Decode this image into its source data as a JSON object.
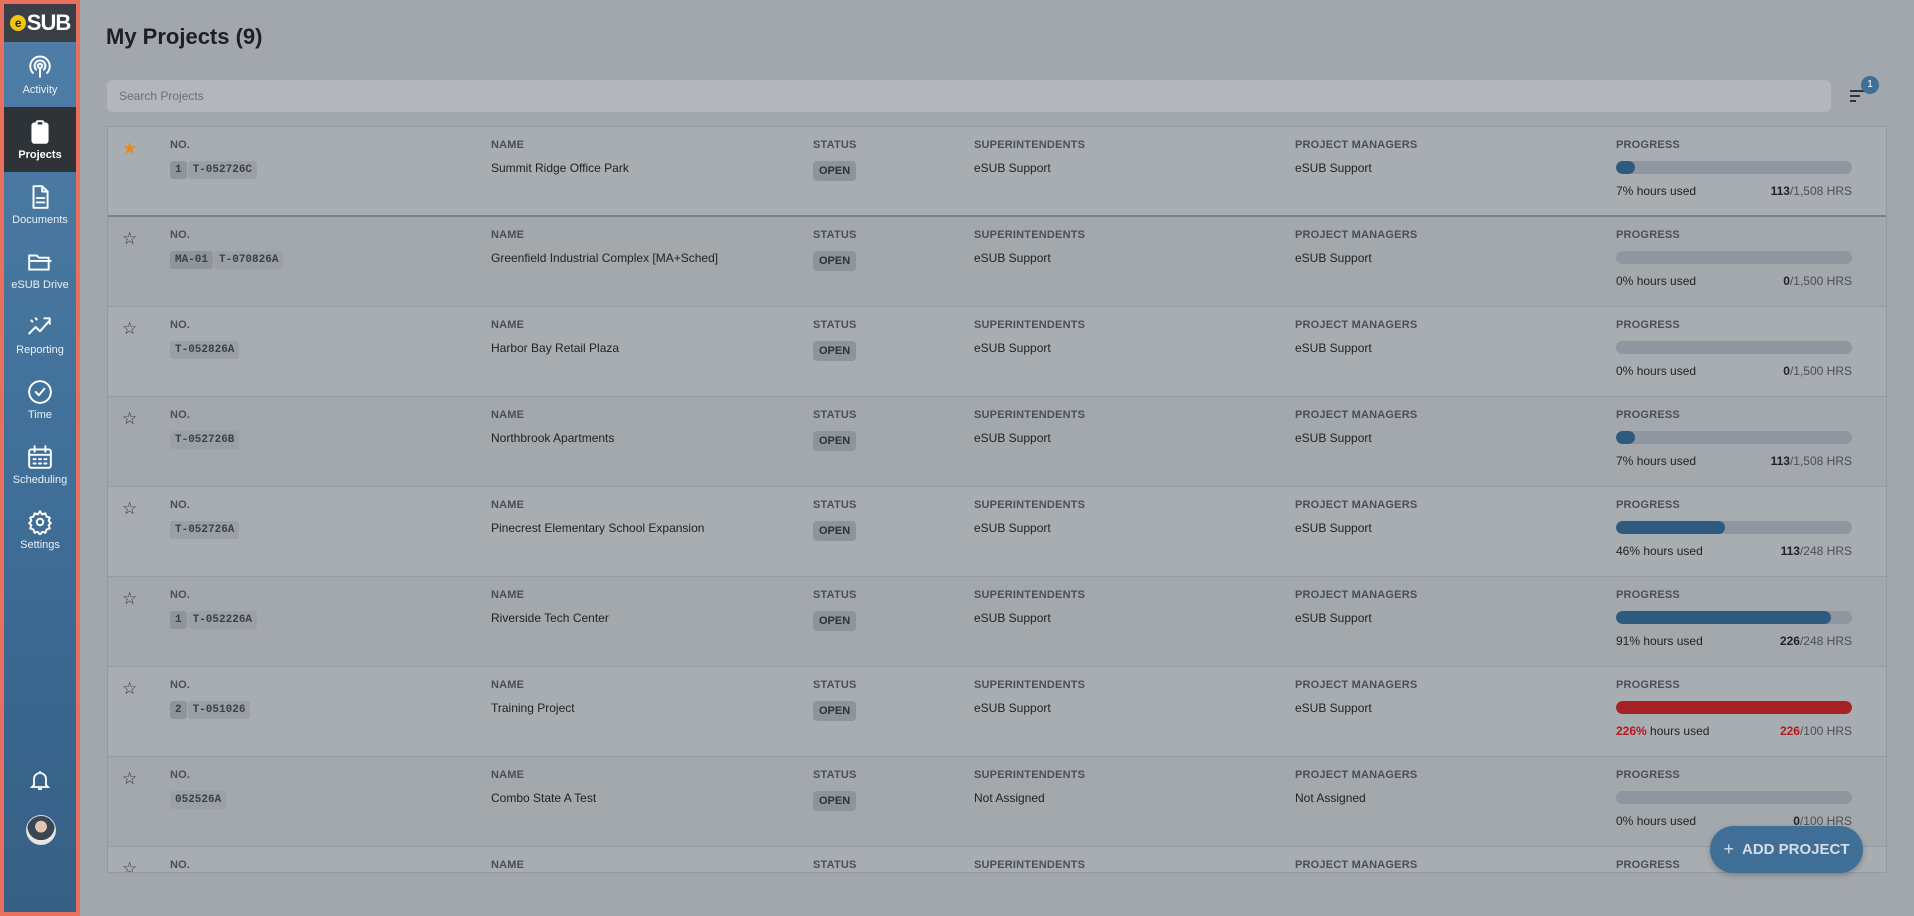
{
  "app": {
    "logo_text": "SUB",
    "logo_e": "e"
  },
  "sidebar": {
    "items": [
      {
        "label": "Activity",
        "icon": "activity-icon"
      },
      {
        "label": "Projects",
        "icon": "clipboard-icon",
        "active": true
      },
      {
        "label": "Documents",
        "icon": "document-icon"
      },
      {
        "label": "eSUB Drive",
        "icon": "folder-icon"
      },
      {
        "label": "Reporting",
        "icon": "reporting-icon"
      },
      {
        "label": "Time",
        "icon": "clock-icon"
      },
      {
        "label": "Scheduling",
        "icon": "calendar-icon"
      },
      {
        "label": "Settings",
        "icon": "gear-icon"
      }
    ]
  },
  "header": {
    "title": "My Projects (9)"
  },
  "search": {
    "placeholder": "Search Projects"
  },
  "filter": {
    "badge": "1"
  },
  "columns": {
    "no": "NO.",
    "name": "NAME",
    "status": "STATUS",
    "superintendents": "SUPERINTENDENTS",
    "project_managers": "PROJECT MANAGERS",
    "progress": "PROGRESS"
  },
  "projects": [
    {
      "starred": true,
      "prefix": "1",
      "number": "T-052726C",
      "name": "Summit Ridge Office Park",
      "status": "OPEN",
      "superintendents": "eSUB Support",
      "project_managers": "eSUB Support",
      "progress_pct": 7,
      "pct_label": "7%",
      "hours_label": "hours used",
      "used": "113",
      "total": "/1,508 HRS",
      "over": false
    },
    {
      "starred": false,
      "prefix": "MA-01",
      "number": "T-070826A",
      "name": "Greenfield Industrial Complex [MA+Sched]",
      "status": "OPEN",
      "superintendents": "eSUB Support",
      "project_managers": "eSUB Support",
      "progress_pct": 0,
      "pct_label": "0%",
      "hours_label": "hours used",
      "used": "0",
      "total": "/1,500 HRS",
      "over": false
    },
    {
      "starred": false,
      "prefix": "",
      "number": "T-052826A",
      "name": "Harbor Bay Retail Plaza",
      "status": "OPEN",
      "superintendents": "eSUB Support",
      "project_managers": "eSUB Support",
      "progress_pct": 0,
      "pct_label": "0%",
      "hours_label": "hours used",
      "used": "0",
      "total": "/1,500 HRS",
      "over": false
    },
    {
      "starred": false,
      "prefix": "",
      "number": "T-052726B",
      "name": "Northbrook Apartments",
      "status": "OPEN",
      "superintendents": "eSUB Support",
      "project_managers": "eSUB Support",
      "progress_pct": 7,
      "pct_label": "7%",
      "hours_label": "hours used",
      "used": "113",
      "total": "/1,508 HRS",
      "over": false
    },
    {
      "starred": false,
      "prefix": "",
      "number": "T-052726A",
      "name": "Pinecrest Elementary School Expansion",
      "status": "OPEN",
      "superintendents": "eSUB Support",
      "project_managers": "eSUB Support",
      "progress_pct": 46,
      "pct_label": "46%",
      "hours_label": "hours used",
      "used": "113",
      "total": "/248 HRS",
      "over": false
    },
    {
      "starred": false,
      "prefix": "1",
      "number": "T-052226A",
      "name": "Riverside Tech Center",
      "status": "OPEN",
      "superintendents": "eSUB Support",
      "project_managers": "eSUB Support",
      "progress_pct": 91,
      "pct_label": "91%",
      "hours_label": "hours used",
      "used": "226",
      "total": "/248 HRS",
      "over": false
    },
    {
      "starred": false,
      "prefix": "2",
      "number": "T-051026",
      "name": "Training Project",
      "status": "OPEN",
      "superintendents": "eSUB Support",
      "project_managers": "eSUB Support",
      "progress_pct": 100,
      "pct_label": "226%",
      "hours_label": "hours used",
      "used": "226",
      "total": "/100 HRS",
      "over": true
    },
    {
      "starred": false,
      "prefix": "",
      "number": "052526A",
      "name": "Combo State A Test",
      "status": "OPEN",
      "superintendents": "Not Assigned",
      "project_managers": "Not Assigned",
      "progress_pct": 0,
      "pct_label": "0%",
      "hours_label": "hours used",
      "used": "0",
      "total": "/100 HRS",
      "over": false
    }
  ],
  "add_button": {
    "label": "ADD PROJECT",
    "icon": "plus-icon"
  }
}
